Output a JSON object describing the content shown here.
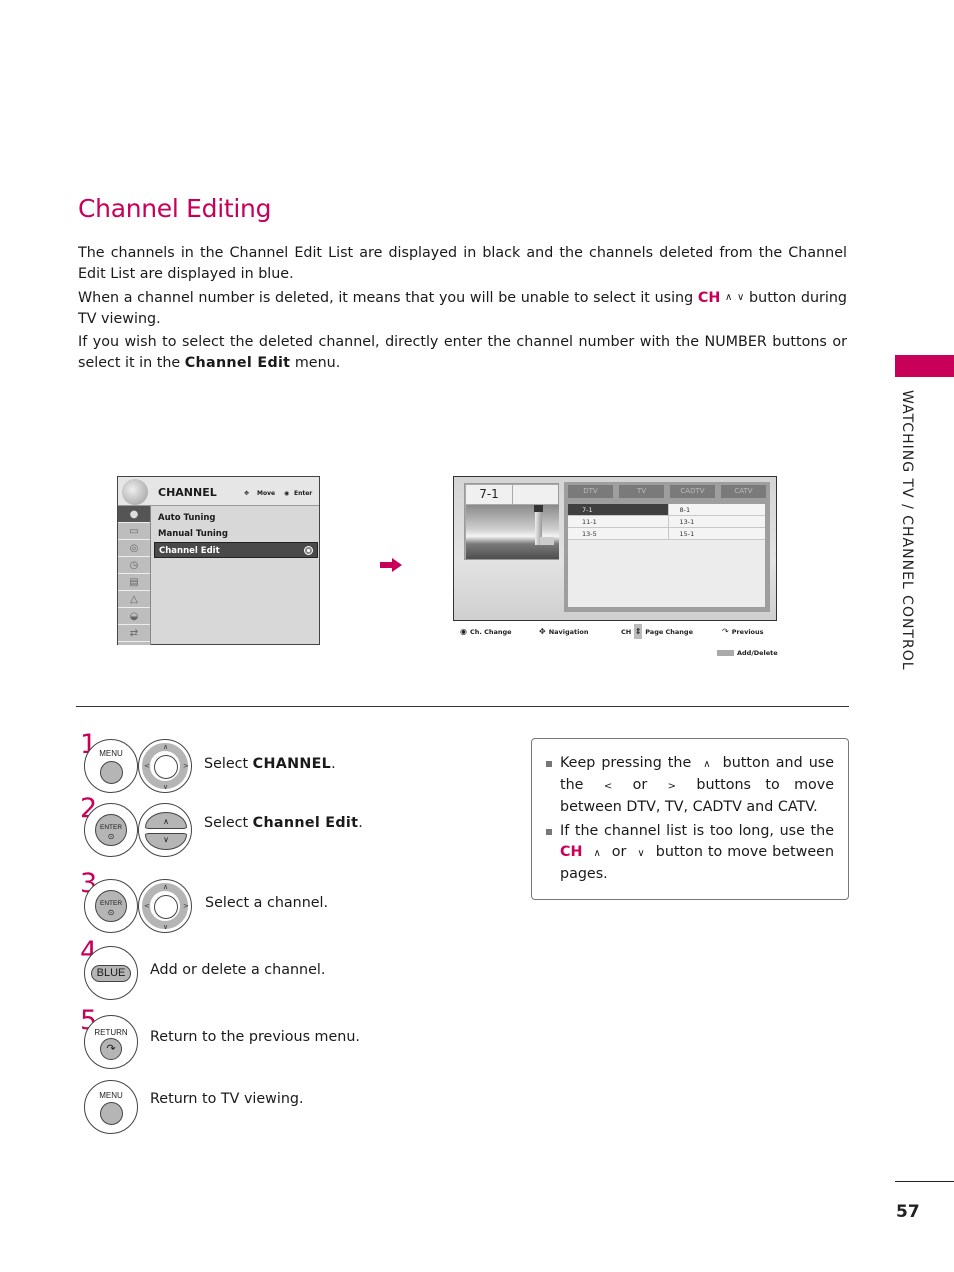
{
  "page": {
    "title": "Channel Editing",
    "section_label": "WATCHING TV / CHANNEL CONTROL",
    "page_number": "57",
    "accent_color": "#c8005a"
  },
  "intro": {
    "p1": "The channels in the Channel Edit List are displayed in black and the channels deleted from the Channel Edit List are displayed in blue.",
    "p2_before": "When a channel number is deleted, it means that you will be unable to select it using ",
    "p2_ch": "CH",
    "p2_up": "∧",
    "p2_down": "∨",
    "p2_after": " button during TV viewing.",
    "p3_before": "If you wish to select the deleted channel, directly enter the channel number with the NUMBER buttons or select it in the ",
    "p3_bold": "Channel Edit",
    "p3_after": " menu."
  },
  "menu_screen": {
    "title": "CHANNEL",
    "hint_move": "Move",
    "hint_enter": "Enter",
    "side_icons": [
      "channel-icon",
      "picture-icon",
      "audio-icon",
      "time-icon",
      "option-icon",
      "lock-icon",
      "usb-icon",
      "input-icon"
    ],
    "items": [
      {
        "label": "Auto Tuning",
        "selected": false
      },
      {
        "label": "Manual Tuning",
        "selected": false
      },
      {
        "label": "Channel Edit",
        "selected": true
      }
    ]
  },
  "edit_screen": {
    "current_channel": "7-1",
    "tabs": [
      "DTV",
      "TV",
      "CADTV",
      "CATV"
    ],
    "active_tab": "DTV",
    "channels": [
      [
        "7-1",
        "8-1"
      ],
      [
        "11-1",
        "13-1"
      ],
      [
        "13-5",
        "15-1"
      ]
    ],
    "selected_channel": "7-1",
    "legend": {
      "ch_change": "Ch. Change",
      "navigation": "Navigation",
      "ch_label": "CH",
      "page_change": "Page Change",
      "previous": "Previous",
      "add_delete": "Add/Delete"
    }
  },
  "steps": [
    {
      "number": "1",
      "button": "MENU",
      "text_before": "Select ",
      "text_bold": "CHANNEL",
      "text_after": "."
    },
    {
      "number": "2",
      "button": "ENTER",
      "text_before": "Select ",
      "text_bold": "Channel Edit",
      "text_after": "."
    },
    {
      "number": "3",
      "button": "ENTER",
      "text": "Select a channel."
    },
    {
      "number": "4",
      "button": "BLUE",
      "text": "Add or delete a channel."
    },
    {
      "number": "5",
      "button": "RETURN",
      "text": "Return to the previous menu."
    },
    {
      "number": "",
      "button": "MENU",
      "text": "Return to TV viewing."
    }
  ],
  "notes": {
    "n1_a": "Keep pressing the",
    "n1_up": "∧",
    "n1_b": "button and use the",
    "n1_left": "<",
    "n1_or": "or",
    "n1_right": ">",
    "n1_c": "buttons to move between DTV, TV, CADTV and CATV.",
    "n2_a": "If the channel list is too long, use the",
    "n2_ch": "CH",
    "n2_up": "∧",
    "n2_or": "or",
    "n2_down": "∨",
    "n2_b": "button to move between pages."
  }
}
